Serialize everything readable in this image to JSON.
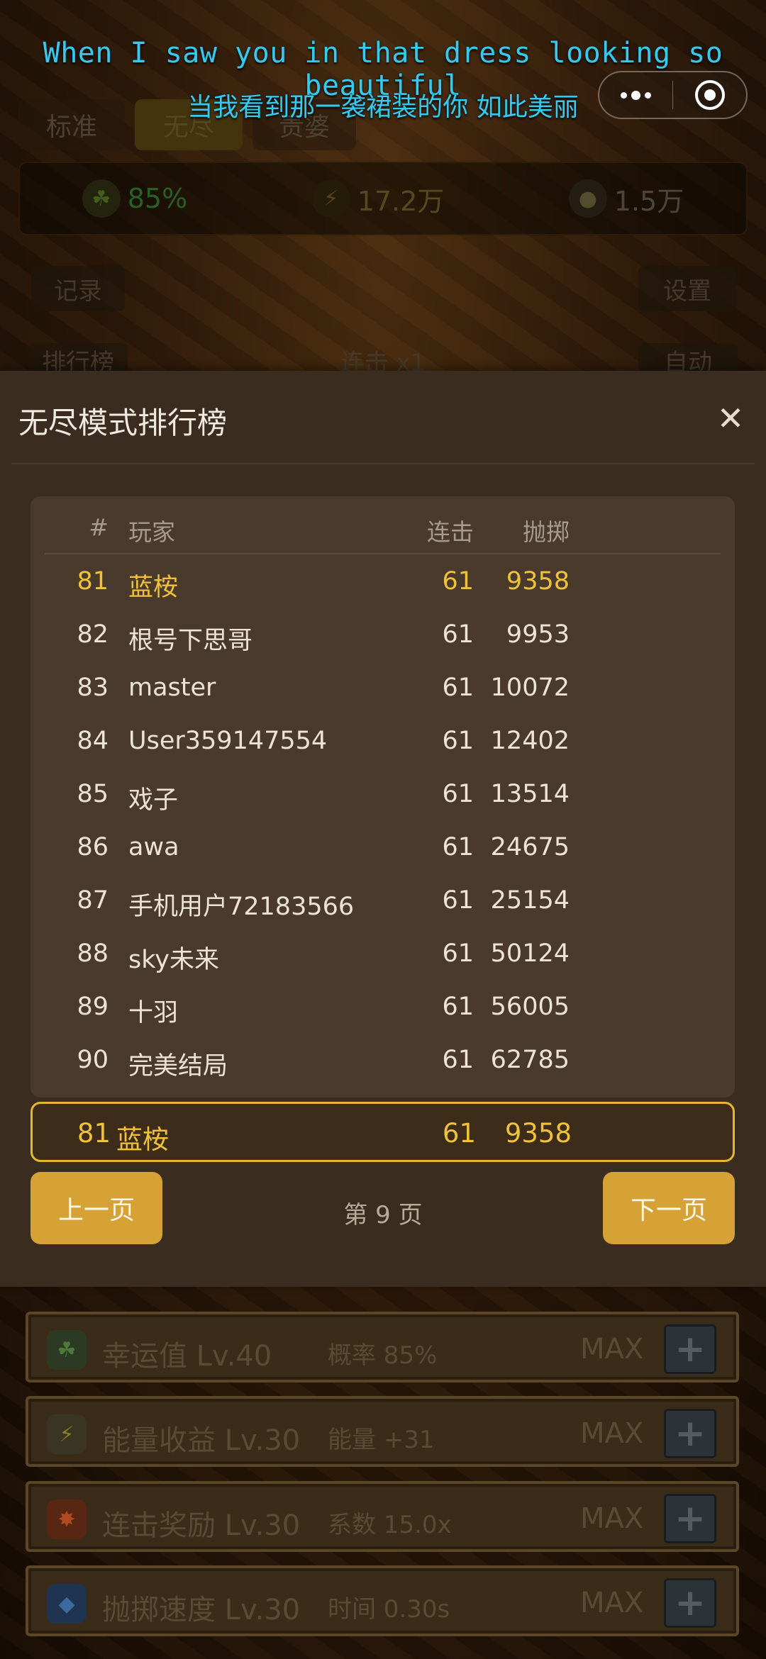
{
  "subtitles": {
    "en": "When I saw you in that dress looking so beautiful",
    "zh": "当我看到那一袭裙装的你 如此美丽"
  },
  "background": {
    "mode_tabs": [
      "标准",
      "无尽",
      "贵婆"
    ],
    "active_mode": "无尽",
    "stats": [
      {
        "icon": "clover-icon",
        "value": "85%",
        "color": "#3f9a3c"
      },
      {
        "icon": "lightning-icon",
        "value": "17.2万",
        "color": "#8a7638"
      },
      {
        "icon": "coin-stack-icon",
        "value": "1.5万",
        "color": "#7c6e5e"
      }
    ],
    "buttons": {
      "records": "记录",
      "settings": "设置",
      "leaderboard": "排行榜",
      "combo": "连击 x1",
      "auto": "自动"
    },
    "upgrades": [
      {
        "icon": "clover-icon",
        "name": "幸运值 Lv.40",
        "desc": "概率 85%",
        "status": "MAX"
      },
      {
        "icon": "shield-lightning-icon",
        "name": "能量收益 Lv.30",
        "desc": "能量 +31",
        "status": "MAX"
      },
      {
        "icon": "combo-badge-icon",
        "name": "连击奖励 Lv.30",
        "desc": "系数 15.0x",
        "status": "MAX"
      },
      {
        "icon": "speed-gem-icon",
        "name": "抛掷速度 Lv.30",
        "desc": "时间 0.30s",
        "status": "MAX"
      }
    ]
  },
  "modal": {
    "title": "无尽模式排行榜",
    "columns": {
      "rank": "#",
      "player": "玩家",
      "combo": "连击",
      "throws": "抛掷"
    },
    "rows": [
      {
        "rank": "81",
        "player": "蓝桉",
        "combo": "61",
        "throws": "9358",
        "is_me": true
      },
      {
        "rank": "82",
        "player": "根号下思哥",
        "combo": "61",
        "throws": "9953"
      },
      {
        "rank": "83",
        "player": "master",
        "combo": "61",
        "throws": "10072"
      },
      {
        "rank": "84",
        "player": "User359147554",
        "combo": "61",
        "throws": "12402"
      },
      {
        "rank": "85",
        "player": "戏子",
        "combo": "61",
        "throws": "13514"
      },
      {
        "rank": "86",
        "player": "awa",
        "combo": "61",
        "throws": "24675"
      },
      {
        "rank": "87",
        "player": "手机用户72183566",
        "combo": "61",
        "throws": "25154"
      },
      {
        "rank": "88",
        "player": "sky未来",
        "combo": "61",
        "throws": "50124"
      },
      {
        "rank": "89",
        "player": "十羽",
        "combo": "61",
        "throws": "56005"
      },
      {
        "rank": "90",
        "player": "完美结局",
        "combo": "61",
        "throws": "62785"
      }
    ],
    "my_entry": {
      "rank": "81",
      "player": "蓝桉",
      "combo": "61",
      "throws": "9358"
    },
    "prev_label": "上一页",
    "next_label": "下一页",
    "page_label": "第 9 页"
  }
}
